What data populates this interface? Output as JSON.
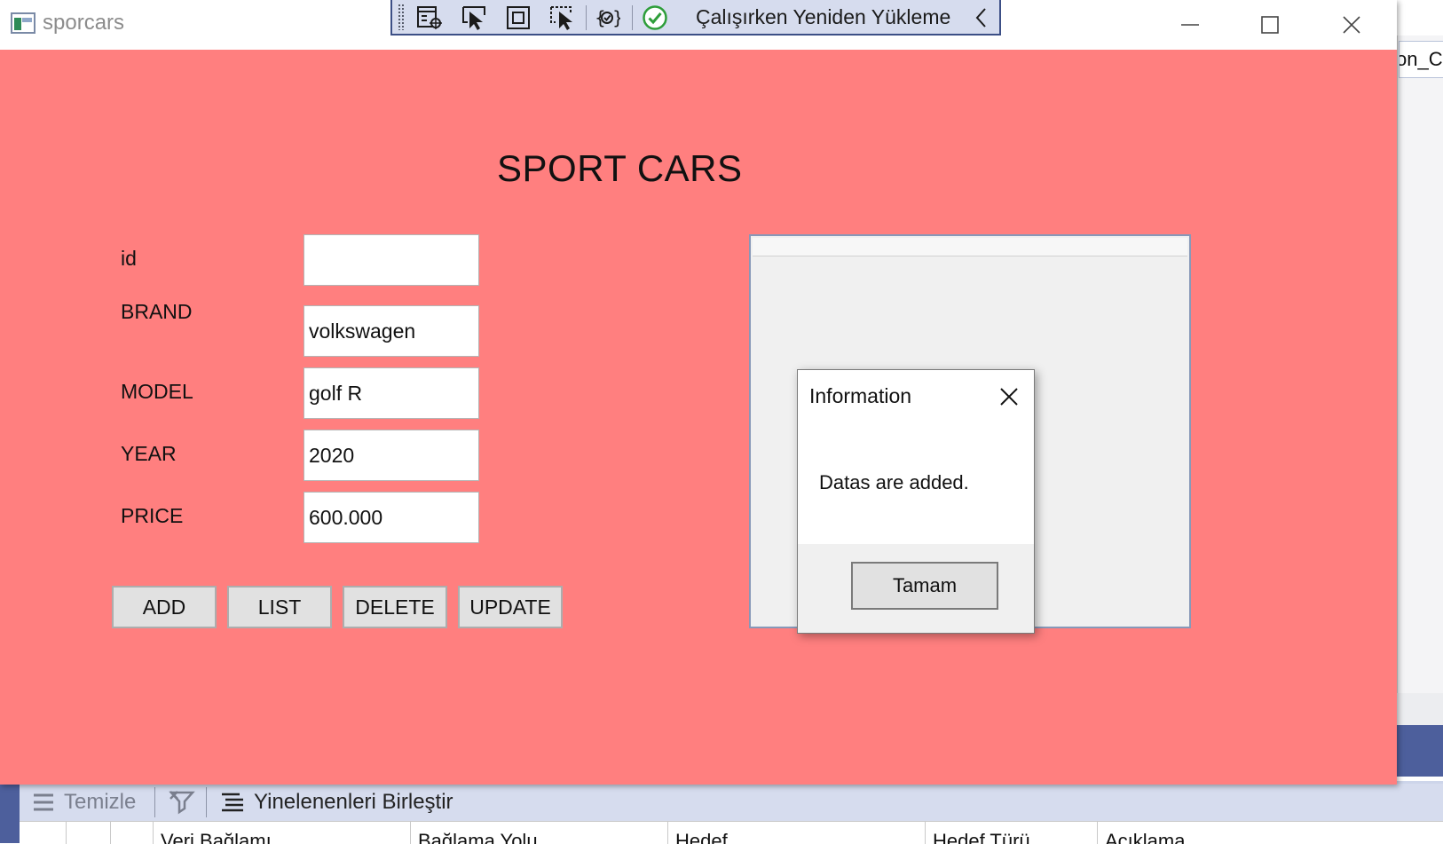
{
  "window": {
    "title": "sporcars"
  },
  "debug_toolbar": {
    "hot_reload_label": "Çalışırken Yeniden Yükleme"
  },
  "background": {
    "right_tab_text": "on_Cli",
    "bottom_toolbar": {
      "clear_label": "Temizle",
      "merge_duplicates_label": "Yinelenenleri Birleştir"
    },
    "grid_columns": [
      "Veri Bağlamı",
      "Bağlama Yolu",
      "Hedef",
      "Hedef Türü",
      "Açıklama"
    ]
  },
  "form": {
    "title": "SPORT CARS",
    "fields": {
      "id": {
        "label": "id",
        "value": ""
      },
      "brand": {
        "label": "BRAND",
        "value": "volkswagen"
      },
      "model": {
        "label": "MODEL",
        "value": "golf R"
      },
      "year": {
        "label": "YEAR",
        "value": "2020"
      },
      "price": {
        "label": "PRICE",
        "value": "600.000"
      }
    },
    "buttons": {
      "add": "ADD",
      "list": "LIST",
      "delete": "DELETE",
      "update": "UPDATE"
    }
  },
  "dialog": {
    "title": "Information",
    "message": "Datas are added.",
    "ok_label": "Tamam"
  },
  "colors": {
    "form_background": "#ff7f7f",
    "toolbar_background": "#d6dcee",
    "hot_reload_check": "#2e9e3a"
  },
  "icons": {
    "app": "window-app-icon",
    "toolbar": [
      "live-visual-tree-icon",
      "select-element-icon",
      "display-layout-adorners-icon",
      "track-focus-icon",
      "binding-failures-icon",
      "hot-reload-check-icon",
      "collapse-chevron-icon"
    ],
    "window_controls": [
      "minimize-icon",
      "maximize-icon",
      "close-icon"
    ]
  }
}
